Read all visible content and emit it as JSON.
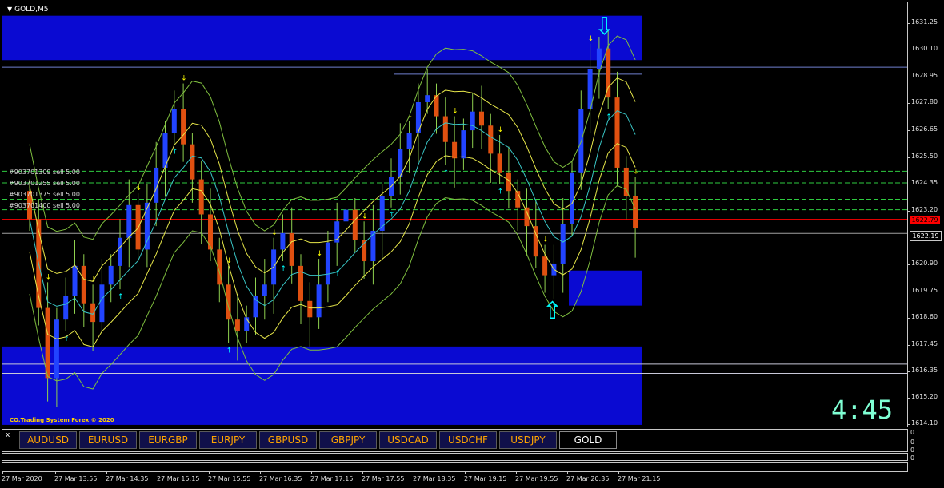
{
  "chart": {
    "title": "GOLD,M5",
    "copyright": "CO.Trading System Forex © 2020",
    "countdown": "4:45",
    "colors": {
      "background": "#000000",
      "zone": "#0a0ad2",
      "bull_candle": "#2244ff",
      "bear_candle": "#e05010",
      "bid_line": "#ff0000",
      "up_arrow": "#00ffff",
      "down_arrow": "#ffff00",
      "order_line": "#2ecc40"
    },
    "orders": [
      "#903701309 sell 5.00",
      "#903701255 sell 5.00",
      "#903701375 sell 5.00",
      "#903701400 sell 5.00"
    ],
    "bid_price": "1622.79",
    "ask_price": "1622.19"
  },
  "price_scale": {
    "ticks": [
      "1631.25",
      "1630.10",
      "1628.95",
      "1627.80",
      "1626.65",
      "1625.50",
      "1624.35",
      "1623.20",
      "1620.90",
      "1619.75",
      "1618.60",
      "1617.45",
      "1616.35",
      "1615.20",
      "1614.10"
    ]
  },
  "sub_scale": {
    "ticks": [
      "0",
      "0",
      "0",
      "0"
    ]
  },
  "symbols": {
    "close": "x",
    "items": [
      {
        "label": "AUDUSD",
        "name": "symbol-audusd"
      },
      {
        "label": "EURUSD",
        "name": "symbol-eurusd"
      },
      {
        "label": "EURGBP",
        "name": "symbol-eurgbp"
      },
      {
        "label": "EURJPY",
        "name": "symbol-eurjpy"
      },
      {
        "label": "GBPUSD",
        "name": "symbol-gbpusd"
      },
      {
        "label": "GBPJPY",
        "name": "symbol-gbpjpy"
      },
      {
        "label": "USDCAD",
        "name": "symbol-usdcad"
      },
      {
        "label": "USDCHF",
        "name": "symbol-usdchf"
      },
      {
        "label": "USDJPY",
        "name": "symbol-usdjpy"
      },
      {
        "label": "GOLD",
        "name": "symbol-gold"
      }
    ],
    "active": "GOLD"
  },
  "time_axis": {
    "ticks": [
      "27 Mar 2020",
      "27 Mar 13:55",
      "27 Mar 14:35",
      "27 Mar 15:15",
      "27 Mar 15:55",
      "27 Mar 16:35",
      "27 Mar 17:15",
      "27 Mar 17:55",
      "27 Mar 18:35",
      "27 Mar 19:15",
      "27 Mar 19:55",
      "27 Mar 20:35",
      "27 Mar 21:15"
    ]
  }
}
